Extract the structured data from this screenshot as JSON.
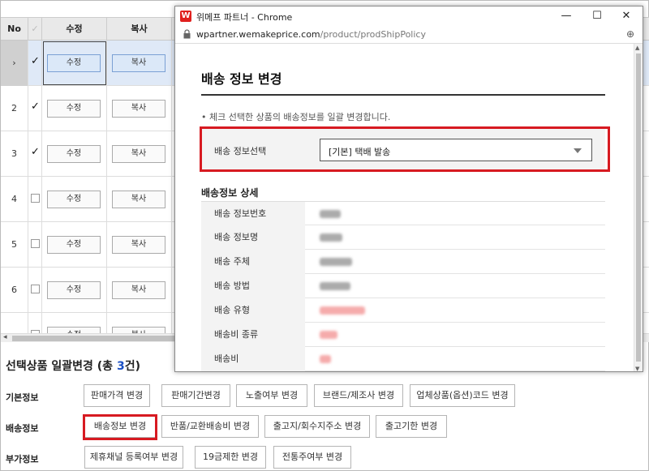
{
  "grid": {
    "headers": {
      "no": "No",
      "edit": "수정",
      "copy": "복사"
    },
    "edit_label": "수정",
    "copy_label": "복사",
    "selected_marker": "›",
    "checked_glyph": "✓",
    "rows": [
      {
        "no": "",
        "checked": true,
        "selected": true
      },
      {
        "no": "2",
        "checked": true
      },
      {
        "no": "3",
        "checked": true
      },
      {
        "no": "4",
        "checked": false
      },
      {
        "no": "5",
        "checked": false
      },
      {
        "no": "6",
        "checked": false
      },
      {
        "no": "",
        "checked": false
      }
    ]
  },
  "bulk": {
    "title_prefix": "선택상품 일괄변경 (총 ",
    "count": "3",
    "title_suffix": "건)",
    "rows": [
      {
        "label": "기본정보",
        "buttons": [
          "판매가격 변경",
          "판매기간변경",
          "노출여부 변경",
          "브랜드/제조사 변경",
          "업체상품(옵션)코드 변경"
        ]
      },
      {
        "label": "배송정보",
        "buttons": [
          "배송정보 변경",
          "반품/교환배송비 변경",
          "출고지/회수지주소 변경",
          "출고기한 변경"
        ]
      },
      {
        "label": "부가정보",
        "buttons": [
          "제휴채널 등록여부 변경",
          "19금제한 변경",
          "전통주여부 변경"
        ]
      }
    ]
  },
  "popup": {
    "window_title": "위메프 파트너 - Chrome",
    "logo_letter": "W",
    "controls": {
      "minimize": "—",
      "maximize": "☐",
      "close": "✕"
    },
    "url_host": "wpartner.wemakeprice.com",
    "url_path": "/product/prodShipPolicy",
    "zoom_icon": "⊕",
    "title": "배송 정보 변경",
    "note": "• 체크 선택한 상품의 배송정보를 일괄 변경합니다.",
    "select_label": "배송 정보선택",
    "select_value": "[기본] 택배 발송",
    "detail_title": "배송정보 상세",
    "detail_rows": [
      {
        "label": "배송 정보번호",
        "blur": "gray"
      },
      {
        "label": "배송 정보명",
        "blur": "gray"
      },
      {
        "label": "배송 주체",
        "blur": "gray"
      },
      {
        "label": "배송 방법",
        "blur": "gray"
      },
      {
        "label": "배송 유형",
        "blur": "red"
      },
      {
        "label": "배송비 종류",
        "blur": "red"
      },
      {
        "label": "배송비",
        "blur": "red"
      }
    ]
  },
  "colors": {
    "accent_red": "#d71a21",
    "link_blue": "#1a4fc4",
    "selected_row": "#dfe9f7"
  }
}
